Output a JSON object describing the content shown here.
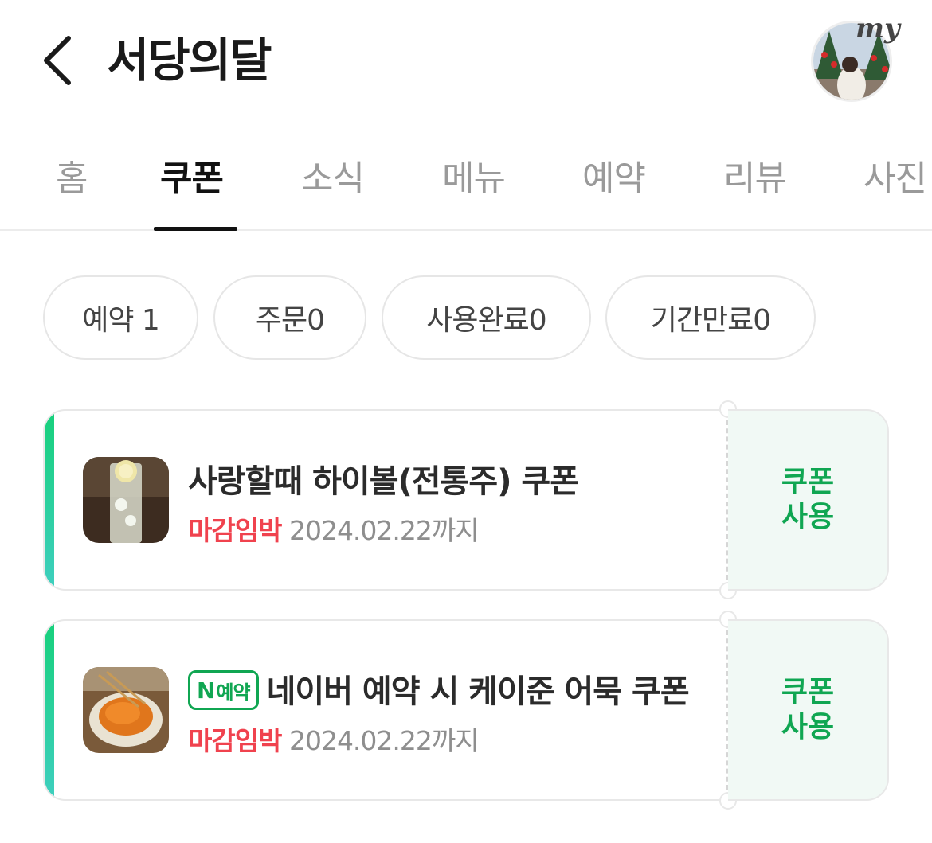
{
  "header": {
    "title": "서당의달",
    "my_label": "my"
  },
  "tabs": [
    {
      "label": "홈"
    },
    {
      "label": "쿠폰",
      "active": true
    },
    {
      "label": "소식"
    },
    {
      "label": "메뉴"
    },
    {
      "label": "예약"
    },
    {
      "label": "리뷰"
    },
    {
      "label": "사진"
    }
  ],
  "filters": [
    {
      "label": "예약 1"
    },
    {
      "label": "주문0"
    },
    {
      "label": "사용완료0"
    },
    {
      "label": "기간만료0"
    }
  ],
  "coupons": [
    {
      "title": "사랑할때 하이볼(전통주) 쿠폰",
      "badge": "",
      "urgency": "마감임박",
      "expiry": "2024.02.22까지",
      "action": "쿠폰 사용"
    },
    {
      "title": "네이버 예약 시 케이준 어묵 쿠폰",
      "badge_letter": "N",
      "badge": "예약",
      "urgency": "마감임박",
      "expiry": "2024.02.22까지",
      "action": "쿠폰 사용"
    }
  ],
  "colors": {
    "accent_green": "#10a652",
    "urgent_red": "#f0424e"
  }
}
